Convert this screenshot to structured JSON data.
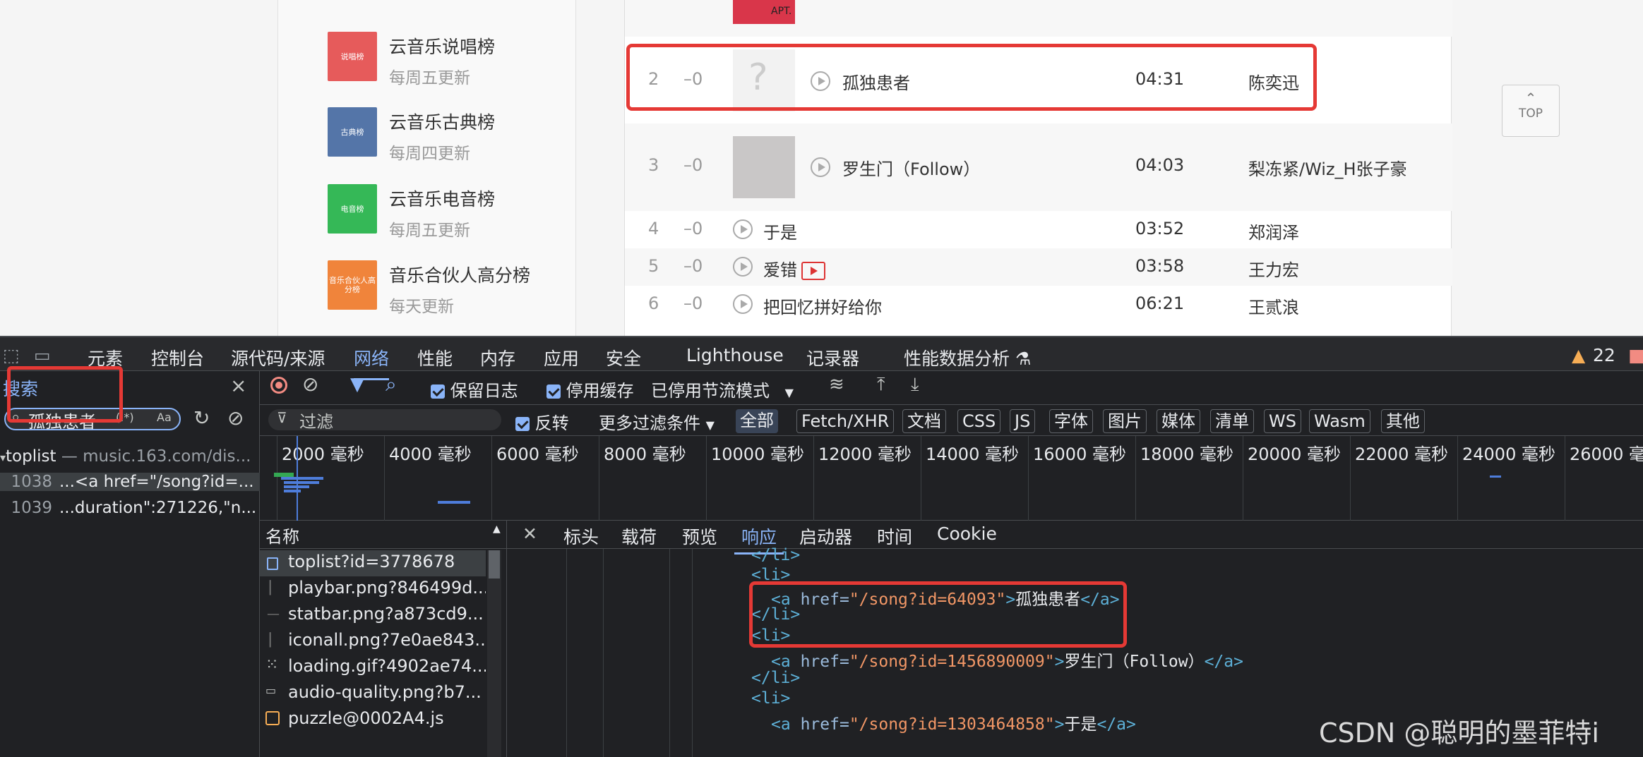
{
  "sidebar": {
    "charts": [
      {
        "name": "云音乐说唱榜",
        "update": "每周五更新",
        "cover_text": "说唱榜",
        "cover_color": "#e65b5b"
      },
      {
        "name": "云音乐古典榜",
        "update": "每周四更新",
        "cover_text": "古典榜",
        "cover_color": "#5475a8"
      },
      {
        "name": "云音乐电音榜",
        "update": "每周五更新",
        "cover_text": "电音榜",
        "cover_color": "#35b857"
      },
      {
        "name": "音乐合伙人高分榜",
        "update": "每天更新",
        "cover_text": "音乐合伙人高分榜",
        "cover_color": "#f0843b"
      }
    ]
  },
  "songs": [
    {
      "rank": "2",
      "trend": "–0",
      "title": "孤独患者",
      "duration": "04:31",
      "artist": "陈奕迅",
      "has_mv": false
    },
    {
      "rank": "3",
      "trend": "–0",
      "title": "罗生门（Follow）",
      "duration": "04:03",
      "artist": "梨冻紧/Wiz_H张子豪",
      "has_mv": false
    },
    {
      "rank": "4",
      "trend": "–0",
      "title": "于是",
      "duration": "03:52",
      "artist": "郑润泽",
      "has_mv": false
    },
    {
      "rank": "5",
      "trend": "–0",
      "title": "爱错",
      "duration": "03:58",
      "artist": "王力宏",
      "has_mv": true
    },
    {
      "rank": "6",
      "trend": "–0",
      "title": "把回忆拼好给你",
      "duration": "06:21",
      "artist": "王贰浪",
      "has_mv": false
    }
  ],
  "top_song_cover_text": "APT.",
  "top_button": "TOP",
  "devtools": {
    "main_tabs": [
      "元素",
      "控制台",
      "源代码/来源",
      "网络",
      "性能",
      "内存",
      "应用",
      "安全",
      "Lighthouse",
      "记录器",
      "性能数据分析 ⚗"
    ],
    "active_tab": "网络",
    "warnings": "22",
    "search": {
      "title": "搜索",
      "query": "孤独患者",
      "options": [
        "(.*)",
        "Aa"
      ],
      "results_file": "toplist",
      "results_url": "— music.163.com/dis...",
      "results": [
        {
          "line": "1038",
          "text": "...<a href=\"/song?id=..."
        },
        {
          "line": "1039",
          "text": "...duration\":271226,\"n..."
        }
      ]
    },
    "toolbar": {
      "preserve_log": "保留日志",
      "disable_cache": "停用缓存",
      "throttling": "已停用节流模式"
    },
    "filter": {
      "placeholder": "过滤",
      "invert": "反转",
      "more_filters": "更多过滤条件",
      "types": [
        "全部",
        "Fetch/XHR",
        "文档",
        "CSS",
        "JS",
        "字体",
        "图片",
        "媒体",
        "清单",
        "WS",
        "Wasm",
        "其他"
      ]
    },
    "timeline_ticks": [
      "2000 毫秒",
      "4000 毫秒",
      "6000 毫秒",
      "8000 毫秒",
      "10000 毫秒",
      "12000 毫秒",
      "14000 毫秒",
      "16000 毫秒",
      "18000 毫秒",
      "20000 毫秒",
      "22000 毫秒",
      "24000 毫秒",
      "26000 毫秒"
    ],
    "name_header": "名称",
    "requests": [
      "toplist?id=3778678",
      "playbar.png?846499d...",
      "statbar.png?a873cd9...",
      "iconall.png?7e0ae843...",
      "loading.gif?4902ae74...",
      "audio-quality.png?b7...",
      "puzzle@0002A4.js"
    ],
    "detail_tabs": [
      "标头",
      "载荷",
      "预览",
      "响应",
      "启动器",
      "时间",
      "Cookie"
    ],
    "active_detail_tab": "响应",
    "response": {
      "li_open": "<li>",
      "li_close": "</li>",
      "a_open": "<a",
      "a_close": "</a>",
      "href_attr": "href=",
      "lines": [
        {
          "href": "\"/song?id=64093\"",
          "text": "孤独患者"
        },
        {
          "href": "\"/song?id=1456890009\"",
          "text": "罗生门（Follow）"
        },
        {
          "href": "\"/song?id=1303464858\"",
          "text": "于是"
        }
      ]
    }
  },
  "watermark": "CSDN @聪明的墨菲特i"
}
